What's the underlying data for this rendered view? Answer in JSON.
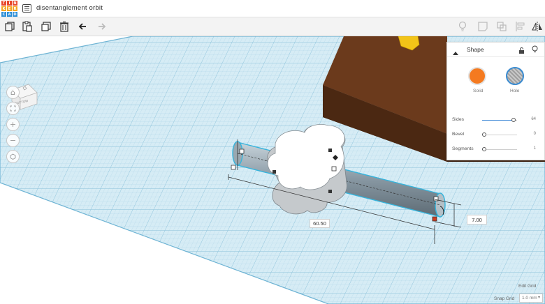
{
  "app": {
    "logo_letters": [
      "T",
      "I",
      "N",
      "K",
      "E",
      "R",
      "C",
      "A",
      "D"
    ],
    "logo_colors": [
      "#e8472a",
      "#e8472a",
      "#e8472a",
      "#f5a623",
      "#f5a623",
      "#f5a623",
      "#2d8fd8",
      "#2d8fd8",
      "#2d8fd8"
    ],
    "title": "disentanglement orbit"
  },
  "toolbar": {
    "buttons": [
      "copy-icon",
      "paste-icon",
      "duplicate-icon",
      "delete-icon",
      "undo-icon",
      "redo-icon"
    ],
    "right_buttons": [
      "light-bulb-icon",
      "note-icon",
      "group-icon",
      "align-icon",
      "mirror-icon"
    ]
  },
  "viewcube": {
    "face_label": "BOTTOM"
  },
  "nav_buttons": [
    "home-icon",
    "fit-view-icon",
    "zoom-in-icon",
    "zoom-out-icon",
    "perspective-icon"
  ],
  "inspector": {
    "title": "Shape",
    "solid_label": "Solid",
    "hole_label": "Hole",
    "solid_color": "#f47a20",
    "properties": [
      {
        "label": "Sides",
        "value": "64",
        "fraction": 0.95
      },
      {
        "label": "Bevel",
        "value": "0",
        "fraction": 0.0
      },
      {
        "label": "Segments",
        "value": "1",
        "fraction": 0.0
      }
    ]
  },
  "dimensions": {
    "length": "60.50",
    "height": "7.00"
  },
  "grid": {
    "edit_grid_label": "Edit Grid",
    "snap_grid_label": "Snap Grid",
    "snap_grid_value": "1.0 mm"
  },
  "colors": {
    "workplane": "#cde8f3",
    "box": "#6b3a1c",
    "accent": "#4a90d9"
  }
}
